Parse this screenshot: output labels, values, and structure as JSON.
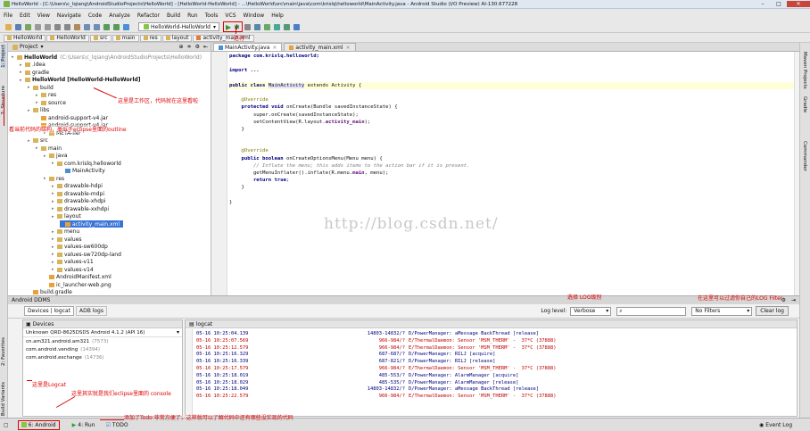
{
  "window": {
    "title": "HelloWorld - [C:\\Users\\c_lqiang\\AndroidStudioProjects\\HelloWorld] - [HelloWorld-HelloWorld] - ...\\HelloWorld\\src\\main\\java\\com\\krislq\\helloworld\\MainActivity.java - Android Studio (I/O Preview) AI-130.677228",
    "min": "–",
    "max": "□",
    "close": "✕"
  },
  "menu": [
    "File",
    "Edit",
    "View",
    "Navigate",
    "Code",
    "Analyze",
    "Refactor",
    "Build",
    "Run",
    "Tools",
    "VCS",
    "Window",
    "Help"
  ],
  "toolbar": {
    "run_config": "HelloWorld-HelloWorld"
  },
  "breadcrumbs": [
    "HelloWorld",
    "HelloWorld",
    "src",
    "main",
    "res",
    "layout",
    "activity_main.xml"
  ],
  "left_tabs": [
    "1: Project",
    "7: Structure",
    "2: Favorites",
    "Build Variants"
  ],
  "right_tabs": [
    "Maven Projects",
    "Gradle",
    "Commander"
  ],
  "project": {
    "header": "Project",
    "tree": [
      {
        "d": 0,
        "t": "HelloWorld",
        "x": "(C:\\Users\\c_lqiang\\AndroidStudioProjects\\HelloWorld)",
        "b": true
      },
      {
        "d": 1,
        "t": ".idea"
      },
      {
        "d": 1,
        "t": "gradle"
      },
      {
        "d": 1,
        "t": "HelloWorld [HelloWorld-HelloWorld]",
        "b": true
      },
      {
        "d": 2,
        "t": "build"
      },
      {
        "d": 3,
        "t": "res"
      },
      {
        "d": 3,
        "t": "source"
      },
      {
        "d": 2,
        "t": "libs"
      },
      {
        "d": 3,
        "t": "android-support-v4.jar"
      },
      {
        "d": 3,
        "t": "android-support-v4.jar"
      },
      {
        "d": 4,
        "t": "META-INF"
      },
      {
        "d": 2,
        "t": "src"
      },
      {
        "d": 3,
        "t": "main"
      },
      {
        "d": 4,
        "t": "java"
      },
      {
        "d": 5,
        "t": "com.krislq.helloworld"
      },
      {
        "d": 6,
        "t": "MainActivity"
      },
      {
        "d": 4,
        "t": "res"
      },
      {
        "d": 5,
        "t": "drawable-hdpi"
      },
      {
        "d": 5,
        "t": "drawable-mdpi"
      },
      {
        "d": 5,
        "t": "drawable-xhdpi"
      },
      {
        "d": 5,
        "t": "drawable-xxhdpi"
      },
      {
        "d": 5,
        "t": "layout"
      },
      {
        "d": 6,
        "t": "activity_main.xml",
        "sel": true
      },
      {
        "d": 5,
        "t": "menu"
      },
      {
        "d": 5,
        "t": "values"
      },
      {
        "d": 5,
        "t": "values-sw600dp"
      },
      {
        "d": 5,
        "t": "values-sw720dp-land"
      },
      {
        "d": 5,
        "t": "values-v11"
      },
      {
        "d": 5,
        "t": "values-v14"
      },
      {
        "d": 4,
        "t": "AndroidManifest.xml"
      },
      {
        "d": 4,
        "t": "ic_launcher-web.png"
      },
      {
        "d": 2,
        "t": "build.gradle"
      }
    ]
  },
  "editor": {
    "tabs": [
      "MainActivity.java",
      "activity_main.xml"
    ],
    "watermark": "http://blog.csdn.net/",
    "lines": [
      [
        [
          "package com.krislq.helloworld;",
          "k"
        ]
      ],
      [
        [
          "",
          ""
        ]
      ],
      [
        [
          "import ...",
          "k"
        ]
      ],
      [
        [
          "",
          ""
        ]
      ],
      [
        [
          "public class ",
          "k"
        ],
        [
          "MainActivity",
          "h"
        ],
        [
          " extends Activity {",
          ""
        ]
      ],
      [
        [
          "",
          ""
        ]
      ],
      [
        [
          "    @Override",
          "a"
        ]
      ],
      [
        [
          "    protected void ",
          "k"
        ],
        [
          "onCreate(Bundle savedInstanceState) {",
          ""
        ]
      ],
      [
        [
          "        super",
          ""
        ],
        [
          ".onCreate(savedInstanceState);",
          ""
        ]
      ],
      [
        [
          "        setContentView(R.layout.",
          ""
        ],
        [
          "activity_main",
          "f"
        ],
        [
          ");",
          ""
        ]
      ],
      [
        [
          "    }",
          ""
        ]
      ],
      [
        [
          "",
          ""
        ]
      ],
      [
        [
          "",
          ""
        ]
      ],
      [
        [
          "    @Override",
          "a"
        ]
      ],
      [
        [
          "    public boolean ",
          "k"
        ],
        [
          "onCreateOptionsMenu(Menu menu) {",
          ""
        ]
      ],
      [
        [
          "        // Inflate the menu; this adds items to the action bar if it is present.",
          "c"
        ]
      ],
      [
        [
          "        getMenuInflater().inflate(R.menu.",
          ""
        ],
        [
          "main",
          "f"
        ],
        [
          ", menu);",
          ""
        ]
      ],
      [
        [
          "        return true",
          "k"
        ],
        [
          ";",
          ""
        ]
      ],
      [
        [
          "    }",
          ""
        ]
      ],
      [
        [
          "",
          ""
        ]
      ],
      [
        [
          "}",
          ""
        ]
      ]
    ]
  },
  "ddms": {
    "title": "Android DDMS",
    "tabs": [
      "Devices | logcat",
      "ADB logs"
    ],
    "log_level_label": "Log level:",
    "log_level": "Verbose",
    "search_placeholder": "",
    "filter": "No Filters",
    "clear": "Clear log",
    "devices_header": "Devices",
    "device": "Unknown QRD-8625DSDS Android 4.1.2 (API 16)",
    "processes": [
      [
        "cn.am321.android.am321",
        "(7573)"
      ],
      [
        "com.android.vending",
        "(14394)"
      ],
      [
        "com.android.exchange",
        "(14736)"
      ]
    ],
    "logcat_header": "logcat",
    "log_rows": [
      [
        "05-16 10:25:04.139",
        "14803-14832/?",
        "D/PowerManager: aMessage BackThread [release]",
        "d"
      ],
      [
        "05-16 10:25:07.569",
        "966-984/?",
        "E/ThermalDaemon: Sensor 'MSM_THERM' -  37*C (37888)",
        "e"
      ],
      [
        "05-16 10:25:12.579",
        "966-984/?",
        "E/ThermalDaemon: Sensor 'MSM_THERM' -  37*C (37888)",
        "e"
      ],
      [
        "05-16 10:25:16.329",
        "687-687/?",
        "D/PowerManager: RILJ [acquire]",
        "d"
      ],
      [
        "05-16 10:25:16.339",
        "687-821/?",
        "D/PowerManager: RILJ [release]",
        "d"
      ],
      [
        "05-16 10:25:17.579",
        "966-984/?",
        "E/ThermalDaemon: Sensor 'MSM_THERM' -  37*C (37888)",
        "e"
      ],
      [
        "05-16 10:25:18.019",
        "485-553/?",
        "D/PowerManager: AlarmManager [acquire]",
        "d"
      ],
      [
        "05-16 10:25:18.029",
        "485-535/?",
        "D/PowerManager: AlarmManager [release]",
        "d"
      ],
      [
        "05-16 10:25:18.049",
        "14803-14832/?",
        "D/PowerManager: aMessage BackThread [release]",
        "d"
      ],
      [
        "05-16 10:25:22.579",
        "966-984/?",
        "E/ThermalDaemon: Sensor 'MSM_THERM' -  37*C (37888)",
        "e"
      ]
    ]
  },
  "bottom_tabs": [
    "6: Android",
    "4: Run",
    "TODO"
  ],
  "event_log": "Event Log",
  "ann": {
    "run": "运行",
    "workspace": "这里是工作区，代码就在这里看啦",
    "outline": "看当前代码的结构，类似于eclipse里面的outline",
    "loglevel": "选择 LOG级别",
    "filter": "在这里可以过滤你自己的LOG Filter",
    "logcat": "这里是Logcat",
    "console": "这里其实就是我们eclipse里面的 console",
    "todo": "添加了Todo 非常方便了，这样就可以了解代码中还有哪些没实现的代码"
  },
  "colors": {
    "annotation": "#e00000",
    "keyword": "#000080",
    "annotation_code": "#808000",
    "comment": "#808080",
    "field": "#660e7a",
    "log_error": "#c00000",
    "log_debug": "#000080",
    "selection": "#3875d7",
    "highlight_line": "#ffffd7"
  }
}
